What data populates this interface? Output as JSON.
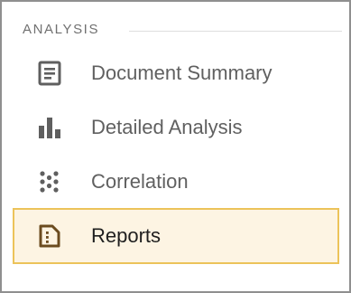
{
  "section": {
    "title": "ANALYSIS"
  },
  "nav": {
    "items": [
      {
        "label": "Document Summary",
        "icon": "document-icon",
        "active": false
      },
      {
        "label": "Detailed Analysis",
        "icon": "bar-chart-icon",
        "active": false
      },
      {
        "label": "Correlation",
        "icon": "scatter-dots-icon",
        "active": false
      },
      {
        "label": "Reports",
        "icon": "report-icon",
        "active": true
      }
    ]
  },
  "colors": {
    "border": "#8f8f8f",
    "icon": "#5f5f5f",
    "active_background": "#fdf4e3",
    "active_border": "#ecc35a",
    "active_icon": "#6b4b1f"
  }
}
